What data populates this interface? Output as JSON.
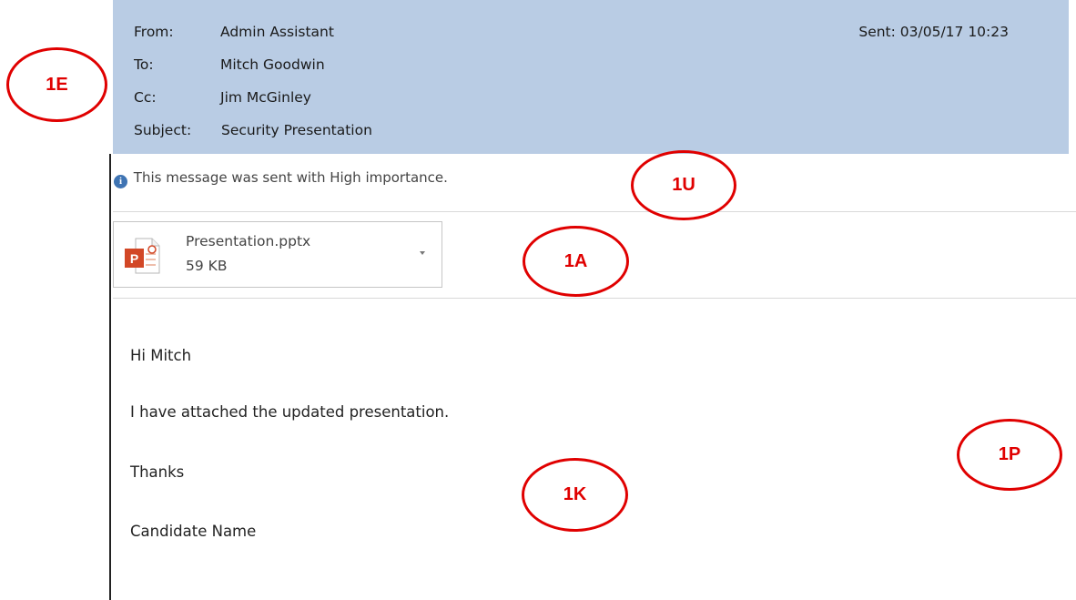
{
  "header": {
    "from_label": "From:",
    "from_value": "Admin Assistant",
    "to_label": "To:",
    "to_value": "Mitch Goodwin",
    "cc_label": "Cc:",
    "cc_value": "Jim McGinley",
    "subject_label": "Subject:",
    "subject_value": "Security Presentation",
    "sent": "Sent: 03/05/17 10:23"
  },
  "info_bar": {
    "icon": "info-icon",
    "text": "This message was sent with High importance."
  },
  "attachment": {
    "icon": "powerpoint-icon",
    "name": "Presentation.pptx",
    "size": "59 KB"
  },
  "body": {
    "lines": [
      "Hi Mitch",
      "I have attached the updated presentation.",
      "Thanks",
      "Candidate Name"
    ]
  },
  "annotations": [
    "1E",
    "1U",
    "1A",
    "1P",
    "1K"
  ],
  "colors": {
    "header_bg": "#b9cce4",
    "annotation": "#e00000",
    "info_icon": "#3f74b3",
    "ppt_red": "#d24726"
  }
}
